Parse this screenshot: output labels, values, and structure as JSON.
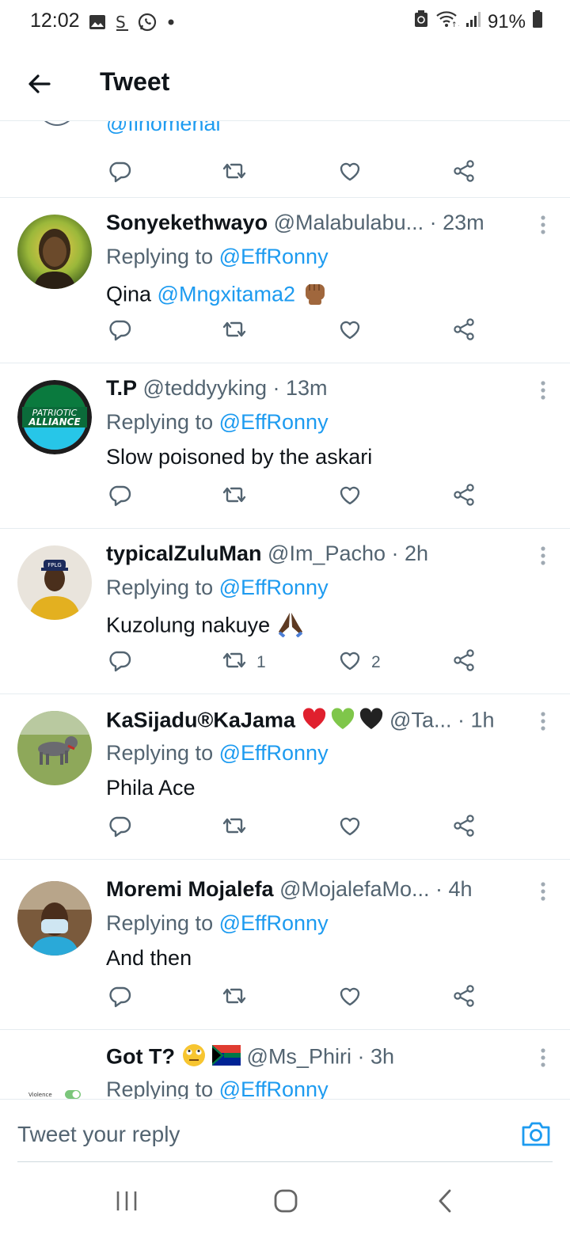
{
  "status": {
    "time": "12:02",
    "battery": "91%"
  },
  "header": {
    "title": "Tweet"
  },
  "partial": {
    "handle": "@finomenal"
  },
  "tweets": [
    {
      "name": "Sonyekethwayo",
      "meta": "@Malabulabu... · 23m",
      "replying_prefix": "Replying to ",
      "replying_to": "@EffRonny",
      "text_before": "Qina ",
      "text_link": "@Mngxitama2",
      "text_after": "",
      "retweets": "",
      "likes": ""
    },
    {
      "name": "T.P",
      "meta": "@teddyyking · 13m",
      "replying_prefix": "Replying to ",
      "replying_to": "@EffRonny",
      "text_before": "Slow poisoned by the askari",
      "text_link": "",
      "text_after": "",
      "retweets": "",
      "likes": ""
    },
    {
      "name": "typicalZuluMan",
      "meta": "@Im_Pacho · 2h",
      "replying_prefix": "Replying to ",
      "replying_to": "@EffRonny",
      "text_before": "Kuzolung nakuye ",
      "text_link": "",
      "text_after": "",
      "retweets": "1",
      "likes": "2"
    },
    {
      "name": "KaSijadu®KaJama",
      "meta": "@Ta... · 1h",
      "replying_prefix": "Replying to ",
      "replying_to": "@EffRonny",
      "text_before": "Phila Ace",
      "text_link": "",
      "text_after": "",
      "retweets": "",
      "likes": ""
    },
    {
      "name": "Moremi Mojalefa",
      "meta": "@MojalefaMo... · 4h",
      "replying_prefix": "Replying to ",
      "replying_to": "@EffRonny",
      "text_before": "And then",
      "text_link": "",
      "text_after": "",
      "retweets": "",
      "likes": ""
    },
    {
      "name": "Got T?",
      "meta": "@Ms_Phiri · 3h",
      "replying_prefix": "Replying to ",
      "replying_to": "@EffRonny",
      "text_before": "",
      "text_link": "",
      "text_after": "",
      "retweets": "",
      "likes": ""
    }
  ],
  "avatar_texts": {
    "patriotic": "PATRIOTIC",
    "alliance": "ALLIANCE",
    "cap": "FPLG",
    "violence": "Violence"
  },
  "composer": {
    "placeholder": "Tweet your reply"
  },
  "colors": {
    "link": "#1d9bf0",
    "muted": "#536471",
    "divider": "#e6ecf0"
  }
}
